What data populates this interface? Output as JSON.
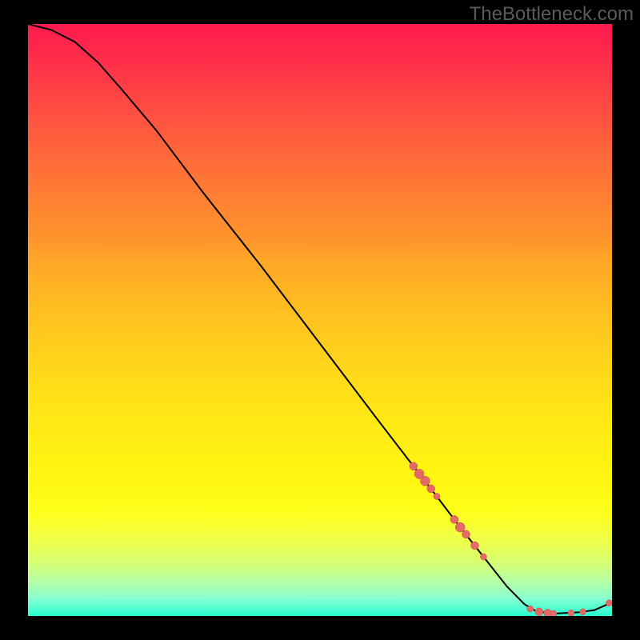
{
  "watermark": "TheBottleneck.com",
  "colors": {
    "marker_fill": "#e36a66",
    "marker_stroke": "#c94d4a",
    "line": "#000000"
  },
  "chart_data": {
    "type": "line",
    "title": "",
    "xlabel": "",
    "ylabel": "",
    "xlim": [
      0,
      100
    ],
    "ylim": [
      0,
      100
    ],
    "curve": [
      {
        "x": 0,
        "y": 100
      },
      {
        "x": 4,
        "y": 99.0
      },
      {
        "x": 8,
        "y": 97.0
      },
      {
        "x": 12,
        "y": 93.5
      },
      {
        "x": 16,
        "y": 89.0
      },
      {
        "x": 22,
        "y": 82.0
      },
      {
        "x": 30,
        "y": 71.5
      },
      {
        "x": 40,
        "y": 59.0
      },
      {
        "x": 50,
        "y": 46.0
      },
      {
        "x": 60,
        "y": 33.0
      },
      {
        "x": 66,
        "y": 25.3
      },
      {
        "x": 70,
        "y": 20.2
      },
      {
        "x": 74,
        "y": 15.0
      },
      {
        "x": 78,
        "y": 10.0
      },
      {
        "x": 82,
        "y": 5.0
      },
      {
        "x": 85,
        "y": 2.0
      },
      {
        "x": 87,
        "y": 0.8
      },
      {
        "x": 90,
        "y": 0.4
      },
      {
        "x": 94,
        "y": 0.6
      },
      {
        "x": 97,
        "y": 1.0
      },
      {
        "x": 100,
        "y": 2.3
      }
    ],
    "markers": [
      {
        "x": 66,
        "y": 25.3,
        "r": 5
      },
      {
        "x": 67,
        "y": 24.0,
        "r": 6
      },
      {
        "x": 68,
        "y": 22.8,
        "r": 6
      },
      {
        "x": 69,
        "y": 21.5,
        "r": 5
      },
      {
        "x": 70,
        "y": 20.2,
        "r": 4
      },
      {
        "x": 73,
        "y": 16.3,
        "r": 5
      },
      {
        "x": 74,
        "y": 15.0,
        "r": 6
      },
      {
        "x": 75,
        "y": 13.8,
        "r": 5
      },
      {
        "x": 76.5,
        "y": 11.9,
        "r": 5
      },
      {
        "x": 78,
        "y": 10.0,
        "r": 4
      },
      {
        "x": 86,
        "y": 1.2,
        "r": 4
      },
      {
        "x": 87.5,
        "y": 0.7,
        "r": 5
      },
      {
        "x": 89,
        "y": 0.5,
        "r": 5
      },
      {
        "x": 90,
        "y": 0.4,
        "r": 4
      },
      {
        "x": 93,
        "y": 0.5,
        "r": 4
      },
      {
        "x": 95,
        "y": 0.7,
        "r": 4
      },
      {
        "x": 99.5,
        "y": 2.2,
        "r": 4
      }
    ]
  }
}
